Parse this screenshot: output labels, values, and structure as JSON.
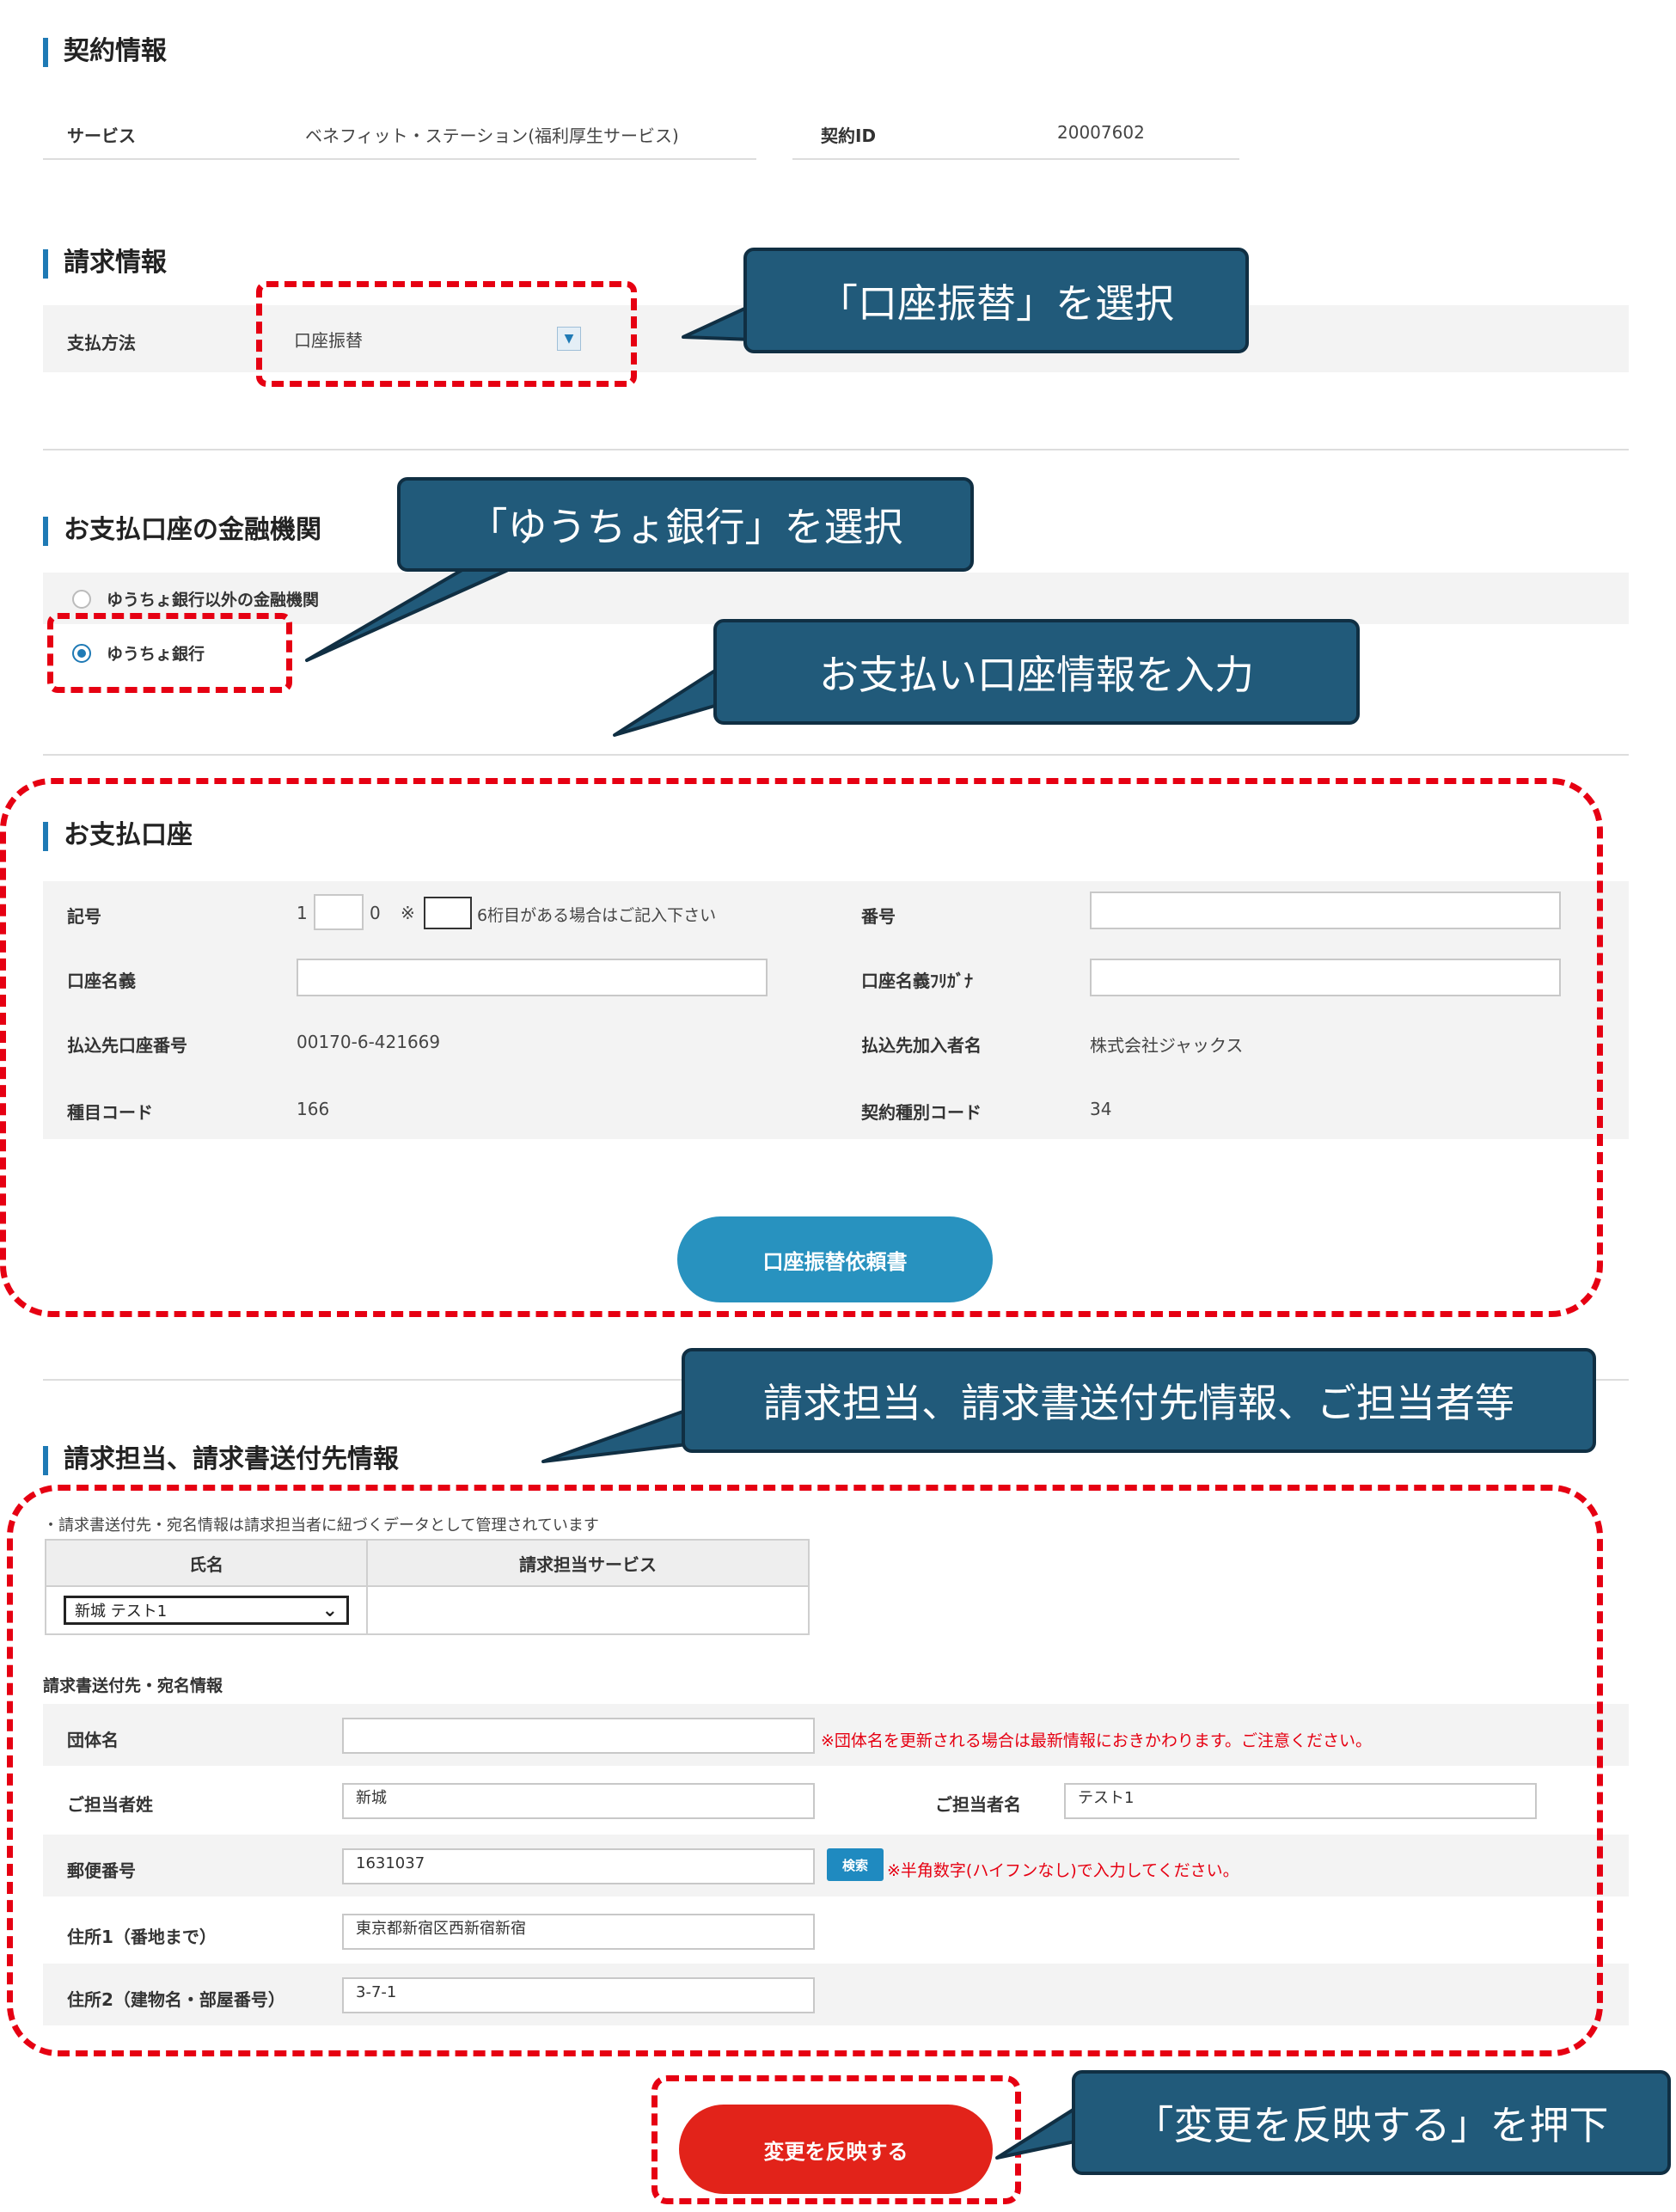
{
  "contract": {
    "title": "契約情報",
    "service_label": "サービス",
    "service_value": "ベネフィット・ステーション(福利厚生サービス)",
    "id_label": "契約ID",
    "id_value": "20007602"
  },
  "billing": {
    "title": "請求情報",
    "payment_method_label": "支払方法",
    "payment_method_value": "口座振替"
  },
  "bank": {
    "title": "お支払口座の金融機関",
    "options": [
      {
        "label": "ゆうちょ銀行以外の金融機関",
        "selected": false
      },
      {
        "label": "ゆうちょ銀行",
        "selected": true
      }
    ]
  },
  "account": {
    "title": "お支払口座",
    "symbol_label": "記号",
    "symbol_prefix": "1",
    "symbol_suffix": "0",
    "symbol_note_mark": "※",
    "symbol_note": "6桁目がある場合はご記入下さい",
    "number_label": "番号",
    "holder_label": "口座名義",
    "holder_kana_label": "口座名義ﾌﾘｶﾞﾅ",
    "dest_number_label": "払込先口座番号",
    "dest_number_value": "00170-6-421669",
    "dest_name_label": "払込先加入者名",
    "dest_name_value": "株式会社ジャックス",
    "item_code_label": "種目コード",
    "item_code_value": "166",
    "contract_code_label": "契約種別コード",
    "contract_code_value": "34",
    "form_button": "口座振替依頼書"
  },
  "invoice": {
    "title": "請求担当、請求書送付先情報",
    "note": "・請求書送付先・宛名情報は請求担当者に紐づくデータとして管理されています",
    "table_headers": [
      "氏名",
      "請求担当サービス"
    ],
    "selected_person": "新城 テスト1",
    "address_title": "請求書送付先・宛名情報",
    "org_label": "団体名",
    "org_value": "",
    "org_note": "※団体名を更新される場合は最新情報におきかわります。ご注意ください。",
    "last_name_label": "ご担当者姓",
    "last_name_value": "新城",
    "first_name_label": "ご担当者名",
    "first_name_value": "テスト1",
    "zip_label": "郵便番号",
    "zip_value": "1631037",
    "search_button": "検索",
    "zip_note": "※半角数字(ハイフンなし)で入力してください。",
    "address1_label": "住所1（番地まで）",
    "address1_value": "東京都新宿区西新宿新宿",
    "address2_label": "住所2（建物名・部屋番号）",
    "address2_value": "3-7-1"
  },
  "submit_button": "変更を反映する",
  "callouts": {
    "select_transfer": "「口座振替」を選択",
    "select_yucho": "「ゆうちょ銀行」を選択",
    "enter_account": "お支払い口座情報を入力",
    "billing_contact": "請求担当、請求書送付先情報、ご担当者等",
    "press_submit": "「変更を反映する」を押下"
  },
  "colors": {
    "accent": "#1f7ab5",
    "callout_bg": "#215a7a",
    "dash_red": "#e60012",
    "button_blue": "#2892bf",
    "button_red": "#e2231a"
  }
}
